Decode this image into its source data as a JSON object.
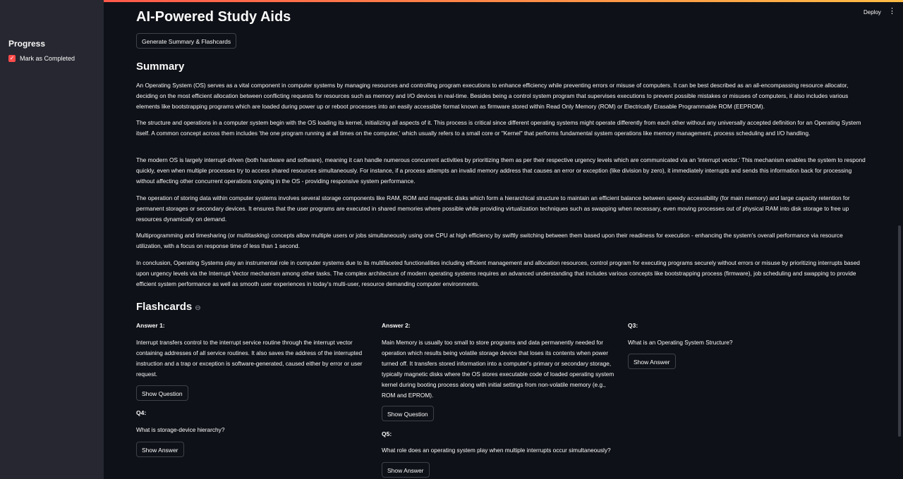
{
  "header": {
    "deploy_label": "Deploy",
    "menu_icon": "vertical-dots-icon"
  },
  "sidebar": {
    "title": "Progress",
    "checkbox_label": "Mark as Completed",
    "checked": true
  },
  "main": {
    "title": "AI-Powered Study Aids",
    "generate_button": "Generate Summary & Flashcards",
    "summary_heading": "Summary",
    "summary_paragraphs": [
      "An Operating System (OS) serves as a vital component in computer systems by managing resources and controlling program executions to enhance efficiency while preventing errors or misuse of computers. It can be best described as an all-encompassing resource allocator, deciding on the most efficient allocation between conflicting requests for resources such as memory and I/O devices in real-time. Besides being a control system program that supervises executions to prevent possible mistakes or misuses of computers, it also includes various elements like bootstrapping programs which are loaded during power up or reboot processes into an easily accessible format known as firmware stored within Read Only Memory (ROM) or Electrically Erasable Programmable ROM (EEPROM).",
      "The structure and operations in a computer system begin with the OS loading its kernel, initializing all aspects of it. This process is critical since different operating systems might operate differently from each other without any universally accepted definition for an Operating System itself. A common concept across them includes 'the one program running at all times on the computer,' which usually refers to a small core or \"Kernel\" that performs fundamental system operations like memory management, process scheduling and I/O handling.",
      "The modern OS is largely interrupt-driven (both hardware and software), meaning it can handle numerous concurrent activities by prioritizing them as per their respective urgency levels which are communicated via an 'interrupt vector.' This mechanism enables the system to respond quickly, even when multiple processes try to access shared resources simultaneously. For instance, if a process attempts an invalid memory address that causes an error or exception (like division by zero), it immediately interrupts and sends this information back for processing without affecting other concurrent operations ongoing in the OS - providing responsive system performance.",
      "The operation of storing data within computer systems involves several storage components like RAM, ROM and magnetic disks which form a hierarchical structure to maintain an efficient balance between speedy accessibility (for main memory) and large capacity retention for permanent storages or secondary devices. It ensures that the user programs are executed in shared memories where possible while providing virtualization techniques such as swapping when necessary, even moving processes out of physical RAM into disk storage to free up resources dynamically on demand.",
      "Multiprogramming and timesharing (or multitasking) concepts allow multiple users or jobs simultaneously using one CPU at high efficiency by swiftly switching between them based upon their readiness for execution - enhancing the system's overall performance via resource utilization, with a focus on response time of less than 1 second.",
      "In conclusion, Operating Systems play an instrumental role in computer systems due to its multifaceted functionalities including efficient management and allocation resources, control program for executing programs securely without errors or misuse by prioritizing interrupts based upon urgency levels via the Interrupt Vector mechanism among other tasks. The complex architecture of modern operating systems requires an advanced understanding that includes various concepts like bootstrapping process (firmware), job scheduling and swapping to provide efficient system performance as well as smooth user experiences in today's multi-user, resource demanding computer environments."
    ],
    "flashcards_heading": "Flashcards",
    "flashcards_link_icon": "link-icon",
    "flashcards": [
      {
        "label": "Answer 1:",
        "text": "Interrupt transfers control to the interrupt service routine through the interrupt vector containing addresses of all service routines. It also saves the address of the interrupted instruction and a trap or exception is software-generated, caused either by error or user request.",
        "button": "Show Question"
      },
      {
        "label": "Answer 2:",
        "text": "Main Memory is usually too small to store programs and data permanently needed for operation which results being volatile storage device that loses its contents when power turned off. It transfers stored information into a computer's primary or secondary storage, typically magnetic disks where the OS stores executable code of loaded operating system kernel during booting process along with initial settings from non-volatile memory (e.g., ROM and EPROM).",
        "button": "Show Question"
      },
      {
        "label": "Q3:",
        "text": "What is an Operating System Structure?",
        "button": "Show Answer"
      },
      {
        "label": "Q4:",
        "text": "What is storage-device hierarchy?",
        "button": "Show Answer"
      },
      {
        "label": "Q5:",
        "text": "What role does an operating system play when multiple interrupts occur simultaneously?",
        "button": "Show Answer"
      }
    ]
  }
}
